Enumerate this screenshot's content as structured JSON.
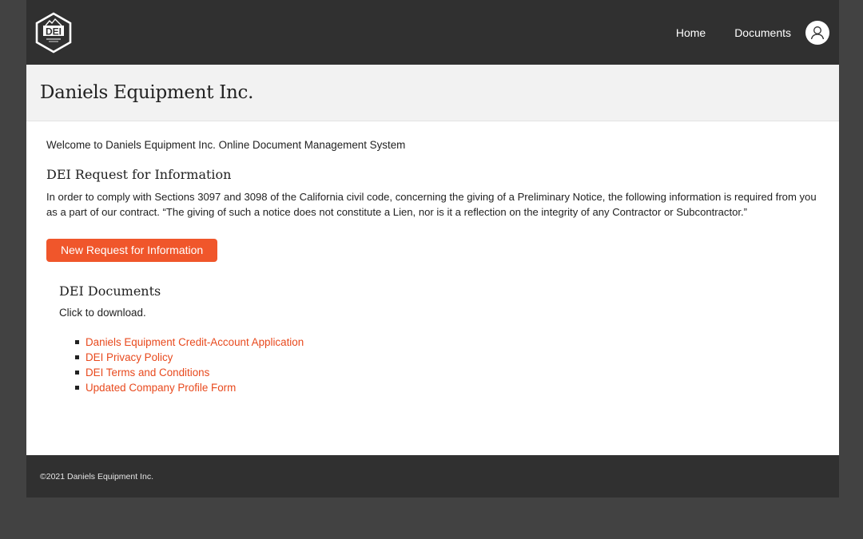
{
  "brand": {
    "logo_text": "DEI",
    "logo_icon": "dei-hexagon-logo"
  },
  "nav": {
    "home_label": "Home",
    "documents_label": "Documents",
    "account_icon": "user-icon"
  },
  "header": {
    "title": "Daniels Equipment Inc."
  },
  "main": {
    "welcome": "Welcome to Daniels Equipment Inc. Online Document Management System",
    "rfi_title": "DEI Request for Information",
    "rfi_text": "In order to comply with Sections 3097 and 3098 of the California civil code, concerning the giving of a Preliminary Notice, the following information is required from you as a part of our contract. “The giving of such a notice does not constitute a Lien, nor is it a reflection on the integrity of any Contractor or Subcontractor.”",
    "rfi_button": "New Request for Information",
    "docs_title": "DEI Documents",
    "docs_hint": "Click to download.",
    "documents": [
      {
        "label": "Daniels Equipment Credit-Account Application"
      },
      {
        "label": "DEI Privacy Policy"
      },
      {
        "label": "DEI Terms and Conditions"
      },
      {
        "label": "Updated Company Profile Form"
      }
    ]
  },
  "footer": {
    "copyright": "©2021 Daniels Equipment Inc."
  },
  "colors": {
    "accent": "#f0562b",
    "link": "#e8491d",
    "topbar": "#303030",
    "background": "#424242"
  }
}
